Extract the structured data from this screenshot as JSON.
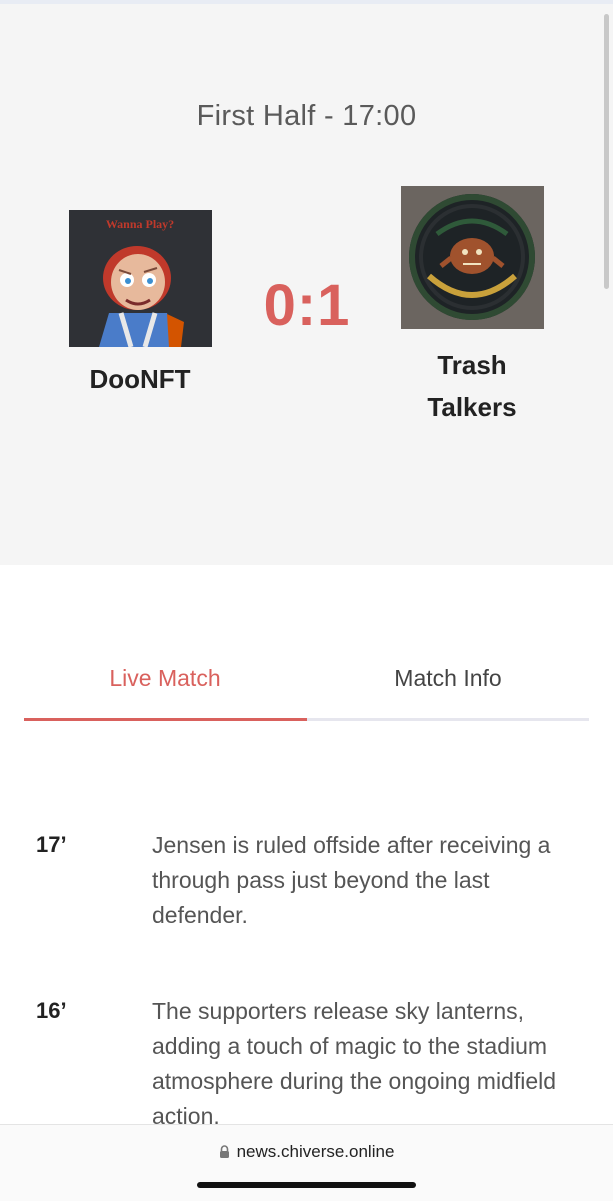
{
  "match": {
    "period": "First Half - 17:00",
    "score": "0:1",
    "home": {
      "name": "DooNFT",
      "logo_caption": "Wanna Play?"
    },
    "away": {
      "name": "Trash Talkers"
    }
  },
  "tabs": [
    {
      "label": "Live Match",
      "active": true
    },
    {
      "label": "Match Info",
      "active": false
    }
  ],
  "events": [
    {
      "minute": "17’",
      "text": "Jensen is ruled offside after receiving a through pass just beyond the last defender."
    },
    {
      "minute": "16’",
      "text": "The supporters release sky lanterns, adding a touch of magic to the stadium atmosphere during the ongoing midfield action."
    }
  ],
  "browser": {
    "url": "news.chiverse.online",
    "lock_icon": "lock-icon"
  },
  "colors": {
    "accent": "#d9615d",
    "header_bg": "#f5f5f5"
  }
}
